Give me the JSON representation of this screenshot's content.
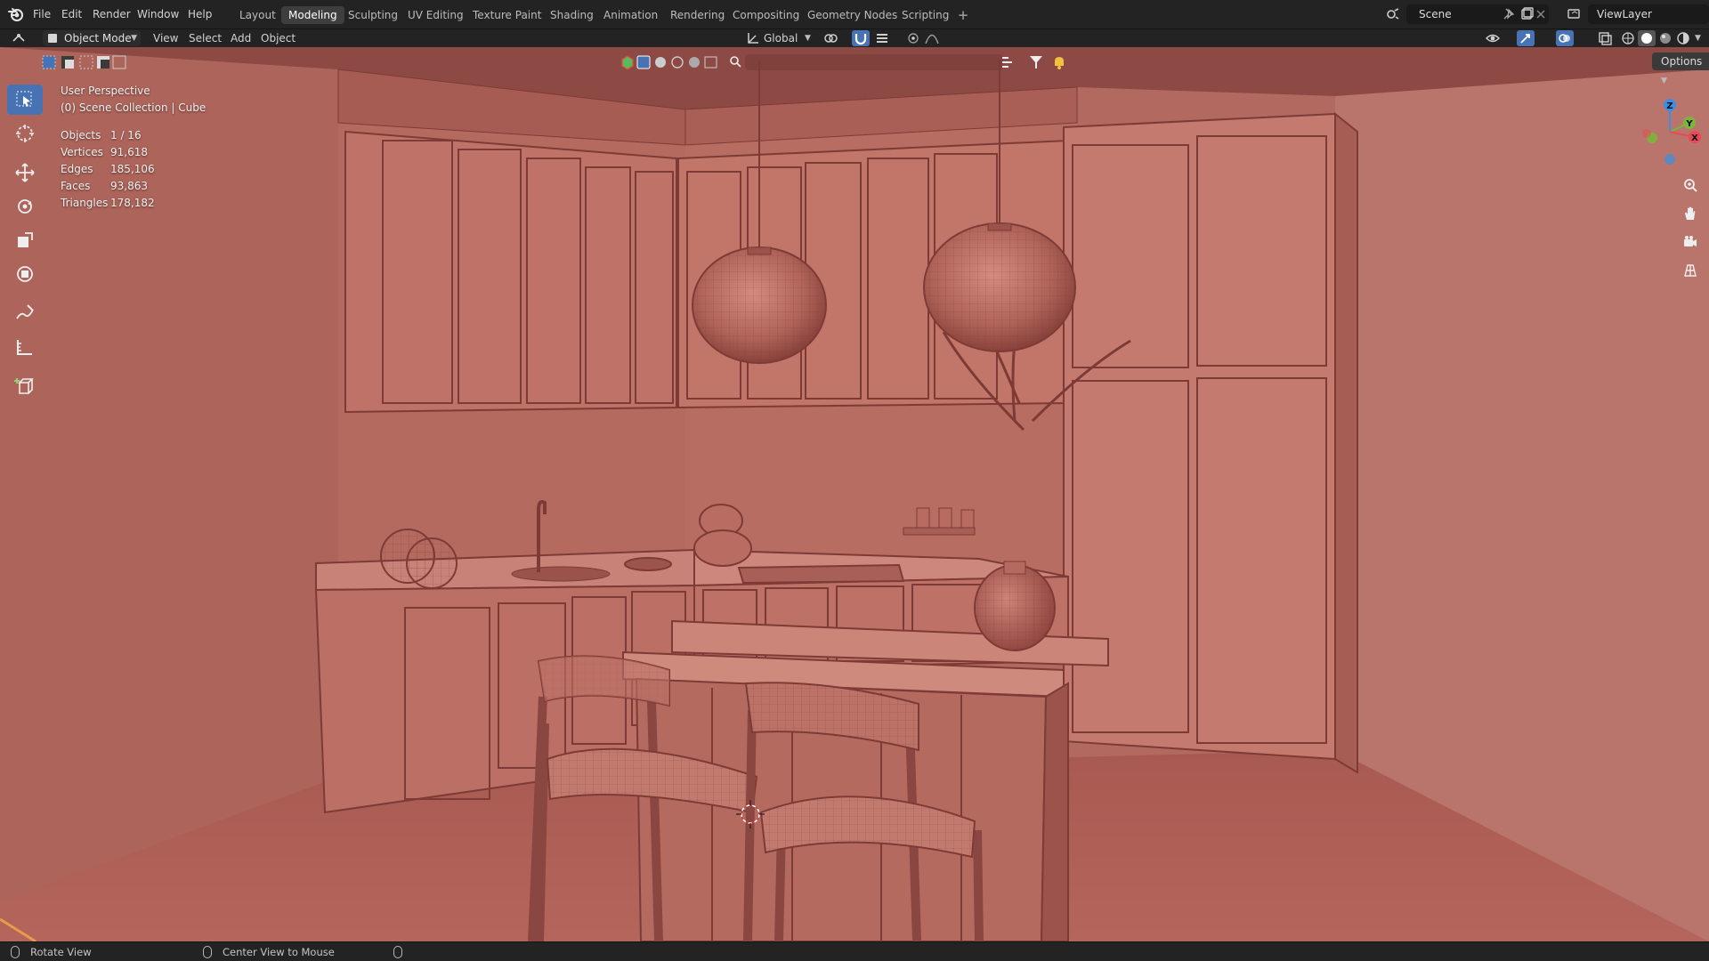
{
  "menu": {
    "items": [
      "File",
      "Edit",
      "Render",
      "Window",
      "Help"
    ]
  },
  "workspaces": {
    "tabs": [
      "Layout",
      "Modeling",
      "Sculpting",
      "UV Editing",
      "Texture Paint",
      "Shading",
      "Animation",
      "Rendering",
      "Compositing",
      "Geometry Nodes",
      "Scripting"
    ],
    "active": "Modeling",
    "add_label": "+"
  },
  "scene": {
    "name": "Scene",
    "view_layer": "ViewLayer"
  },
  "header": {
    "mode": "Object Mode",
    "menus": [
      "View",
      "Select",
      "Add",
      "Object"
    ],
    "transform_orientation": "Global"
  },
  "viewport": {
    "options_label": "Options",
    "perspective": "User Perspective",
    "collection": "(0) Scene Collection | Cube",
    "stats": [
      {
        "label": "Objects",
        "value": "1 / 16"
      },
      {
        "label": "Vertices",
        "value": "91,618"
      },
      {
        "label": "Edges",
        "value": "185,106"
      },
      {
        "label": "Faces",
        "value": "93,863"
      },
      {
        "label": "Triangles",
        "value": "178,182"
      }
    ],
    "gizmo_axes": [
      "Z",
      "Y",
      "X"
    ],
    "toolbar_icons": [
      "select-box-icon",
      "cursor-icon",
      "move-icon",
      "rotate-icon",
      "scale-icon",
      "transform-icon",
      "annotate-icon",
      "measure-icon",
      "add-cube-icon"
    ],
    "colors": {
      "viewport_bg": "#b06359",
      "wall": "#b56a60",
      "floor": "#a85a52",
      "cabinet": "#c07469",
      "line": "#7e3b36",
      "active_tool": "#4772b3",
      "axis_x": "#e84a55",
      "axis_y": "#7bb53a",
      "axis_z": "#3c8ee0"
    }
  },
  "statusbar": {
    "left_action": "Rotate View",
    "middle_action": "Center View to Mouse"
  }
}
